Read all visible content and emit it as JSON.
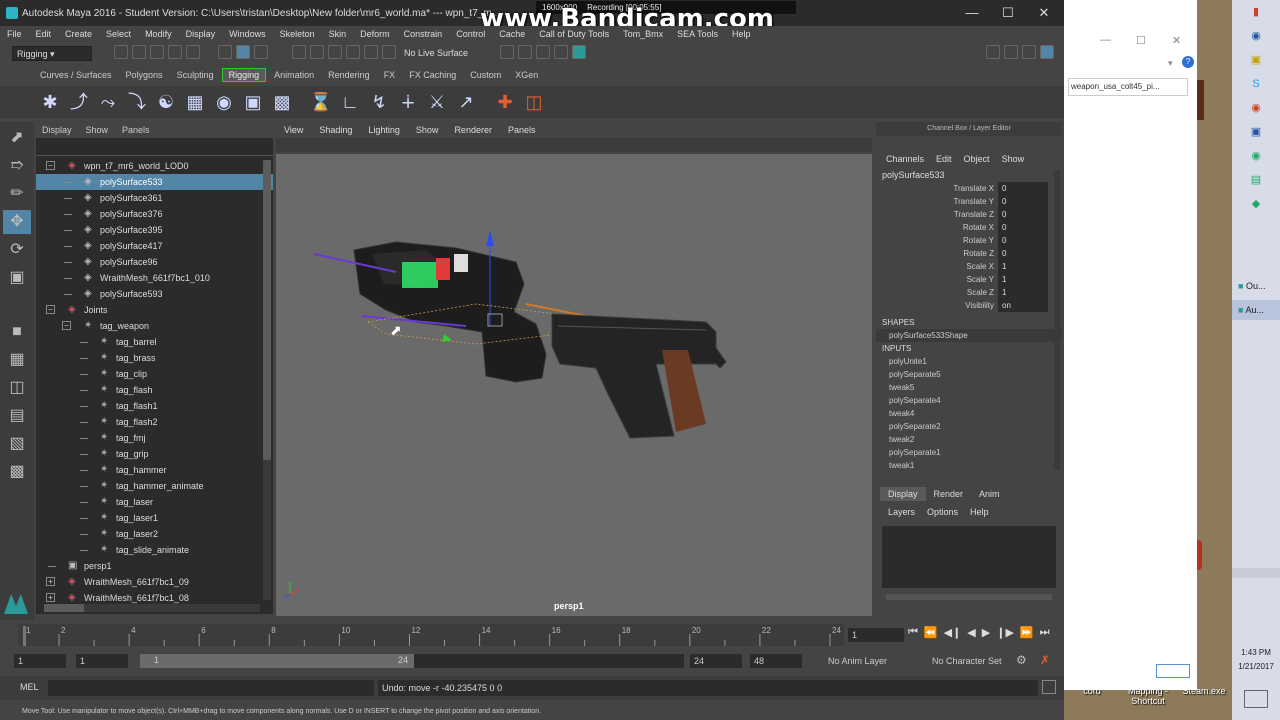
{
  "window": {
    "title": "Autodesk Maya 2016 - Student Version: C:\\Users\\tristan\\Desktop\\New folder\\mr6_world.ma*   ---   wpn_t7_m...",
    "watermark": "www.Bandicam.com",
    "recording": {
      "resolution": "1600x900",
      "label": "Recording [00:05:55]"
    }
  },
  "menu": [
    "File",
    "Edit",
    "Create",
    "Select",
    "Modify",
    "Display",
    "Windows",
    "Skeleton",
    "Skin",
    "Deform",
    "Constrain",
    "Control",
    "Cache",
    "Call of Duty Tools",
    "Tom_Bmx",
    "SEA Tools",
    "Help"
  ],
  "statusline": {
    "menuset": "Rigging",
    "live_surface": "No Live Surface"
  },
  "shelf_tabs": [
    "Curves / Surfaces",
    "Polygons",
    "Sculpting",
    "Rigging",
    "Animation",
    "Rendering",
    "FX",
    "FX Caching",
    "Custom",
    "XGen"
  ],
  "shelf_selected": "Rigging",
  "outliner": {
    "menu": [
      "Display",
      "Show",
      "Panels"
    ],
    "rows": [
      {
        "label": "wpn_t7_mr6_world_LOD0",
        "depth": 0,
        "exp": "−",
        "sel": false,
        "icon": "mesh-group"
      },
      {
        "label": "polySurface533",
        "depth": 1,
        "exp": "",
        "sel": true,
        "icon": "mesh"
      },
      {
        "label": "polySurface361",
        "depth": 1,
        "exp": "",
        "sel": false,
        "icon": "mesh"
      },
      {
        "label": "polySurface376",
        "depth": 1,
        "exp": "",
        "sel": false,
        "icon": "mesh"
      },
      {
        "label": "polySurface395",
        "depth": 1,
        "exp": "",
        "sel": false,
        "icon": "mesh"
      },
      {
        "label": "polySurface417",
        "depth": 1,
        "exp": "",
        "sel": false,
        "icon": "mesh"
      },
      {
        "label": "polySurface96",
        "depth": 1,
        "exp": "",
        "sel": false,
        "icon": "mesh"
      },
      {
        "label": "WraithMesh_661f7bc1_010",
        "depth": 1,
        "exp": "",
        "sel": false,
        "icon": "mesh"
      },
      {
        "label": "polySurface593",
        "depth": 1,
        "exp": "",
        "sel": false,
        "icon": "mesh"
      },
      {
        "label": "Joints",
        "depth": 0,
        "exp": "−",
        "sel": false,
        "icon": "mesh-group"
      },
      {
        "label": "tag_weapon",
        "depth": 1,
        "exp": "−",
        "sel": false,
        "icon": "joint"
      },
      {
        "label": "tag_barrel",
        "depth": 2,
        "exp": "",
        "sel": false,
        "icon": "joint"
      },
      {
        "label": "tag_brass",
        "depth": 2,
        "exp": "",
        "sel": false,
        "icon": "joint"
      },
      {
        "label": "tag_clip",
        "depth": 2,
        "exp": "",
        "sel": false,
        "icon": "joint"
      },
      {
        "label": "tag_flash",
        "depth": 2,
        "exp": "",
        "sel": false,
        "icon": "joint"
      },
      {
        "label": "tag_flash1",
        "depth": 2,
        "exp": "",
        "sel": false,
        "icon": "joint"
      },
      {
        "label": "tag_flash2",
        "depth": 2,
        "exp": "",
        "sel": false,
        "icon": "joint"
      },
      {
        "label": "tag_fmj",
        "depth": 2,
        "exp": "",
        "sel": false,
        "icon": "joint"
      },
      {
        "label": "tag_grip",
        "depth": 2,
        "exp": "",
        "sel": false,
        "icon": "joint"
      },
      {
        "label": "tag_hammer",
        "depth": 2,
        "exp": "",
        "sel": false,
        "icon": "joint"
      },
      {
        "label": "tag_hammer_animate",
        "depth": 2,
        "exp": "",
        "sel": false,
        "icon": "joint"
      },
      {
        "label": "tag_laser",
        "depth": 2,
        "exp": "",
        "sel": false,
        "icon": "joint"
      },
      {
        "label": "tag_laser1",
        "depth": 2,
        "exp": "",
        "sel": false,
        "icon": "joint"
      },
      {
        "label": "tag_laser2",
        "depth": 2,
        "exp": "",
        "sel": false,
        "icon": "joint"
      },
      {
        "label": "tag_slide_animate",
        "depth": 2,
        "exp": "",
        "sel": false,
        "icon": "joint"
      },
      {
        "label": "persp1",
        "depth": 0,
        "exp": "",
        "sel": false,
        "icon": "camera"
      },
      {
        "label": "WraithMesh_661f7bc1_09",
        "depth": 0,
        "exp": "+",
        "sel": false,
        "icon": "mesh-group"
      },
      {
        "label": "WraithMesh_661f7bc1_08",
        "depth": 0,
        "exp": "+",
        "sel": false,
        "icon": "mesh-group"
      }
    ]
  },
  "viewport": {
    "menu": [
      "View",
      "Shading",
      "Lighting",
      "Show",
      "Renderer",
      "Panels"
    ],
    "camera_label": "persp1"
  },
  "channel_box": {
    "header": "Channel Box / Layer Editor",
    "menu": [
      "Channels",
      "Edit",
      "Object",
      "Show"
    ],
    "object": "polySurface533",
    "attributes": [
      {
        "name": "Translate X",
        "value": "0"
      },
      {
        "name": "Translate Y",
        "value": "0"
      },
      {
        "name": "Translate Z",
        "value": "0"
      },
      {
        "name": "Rotate X",
        "value": "0"
      },
      {
        "name": "Rotate Y",
        "value": "0"
      },
      {
        "name": "Rotate Z",
        "value": "0"
      },
      {
        "name": "Scale X",
        "value": "1"
      },
      {
        "name": "Scale Y",
        "value": "1"
      },
      {
        "name": "Scale Z",
        "value": "1"
      },
      {
        "name": "Visibility",
        "value": "on"
      }
    ],
    "shapes_label": "SHAPES",
    "shape": "polySurface533Shape",
    "inputs_label": "INPUTS",
    "inputs": [
      "polyUnite1",
      "polySeparate5",
      "tweak5",
      "polySeparate4",
      "tweak4",
      "polySeparate2",
      "tweak2",
      "polySeparate1",
      "tweak1"
    ]
  },
  "layer_editor": {
    "tabs": [
      "Display",
      "Render",
      "Anim"
    ],
    "selected": "Display",
    "menu": [
      "Layers",
      "Options",
      "Help"
    ]
  },
  "timeline": {
    "ticks": [
      "1",
      "2",
      "4",
      "6",
      "8",
      "10",
      "12",
      "14",
      "16",
      "18",
      "20",
      "22",
      "24"
    ],
    "current": "1",
    "range_start": "1",
    "range_inner_start": "1",
    "range_bar_start": "1",
    "range_bar_end": "24",
    "range_inner_end": "24",
    "range_end": "48",
    "anim_layer": "No Anim Layer",
    "char_set": "No Character Set"
  },
  "command": {
    "label": "MEL",
    "result": "Undo: move -r -40.235475 0 0"
  },
  "help_line": "Move Tool: Use manipulator to move object(s). Ctrl+MMB+drag to move components along normals. Use D or INSERT to change the pivot position and axis orientation.",
  "browser": {
    "url": "weapon_usa_colt45_pi..."
  },
  "desktop_icons": [
    "cord",
    "Mapping - Shortcut",
    "Steam.exe"
  ],
  "taskbar": {
    "items": [
      "Ou...",
      "Au..."
    ],
    "time": "1:43 PM",
    "date": "1/21/2017"
  }
}
